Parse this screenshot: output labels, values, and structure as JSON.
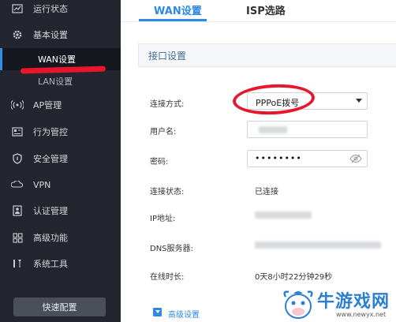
{
  "sidebar": {
    "items": [
      {
        "label": "运行状态",
        "icon": "monitor-icon"
      },
      {
        "label": "基本设置",
        "icon": "gear-icon"
      },
      {
        "label": "AP管理",
        "icon": "wifi-ap-icon"
      },
      {
        "label": "行为管控",
        "icon": "control-icon"
      },
      {
        "label": "安全管理",
        "icon": "shield-icon"
      },
      {
        "label": "VPN",
        "icon": "vpn-icon"
      },
      {
        "label": "认证管理",
        "icon": "auth-icon"
      },
      {
        "label": "高级功能",
        "icon": "grid-icon"
      },
      {
        "label": "系统工具",
        "icon": "tools-icon"
      }
    ],
    "sub_items": [
      {
        "label": "WAN设置",
        "active": true
      },
      {
        "label": "LAN设置",
        "active": false
      }
    ],
    "quick_config": "快速配置"
  },
  "tabs": [
    {
      "label": "WAN设置",
      "active": true
    },
    {
      "label": "ISP选路",
      "active": false
    }
  ],
  "section": {
    "title": "接口设置"
  },
  "form": {
    "connection_type": {
      "label": "连接方式:",
      "value": "PPPoE拨号"
    },
    "username": {
      "label": "用户名:"
    },
    "password": {
      "label": "密码:",
      "value": "••••••••"
    },
    "status": {
      "label": "连接状态:",
      "value": "已连接"
    },
    "ip": {
      "label": "IP地址:"
    },
    "dns": {
      "label": "DNS服务器:"
    },
    "online_time": {
      "label": "在线时长:",
      "value": "0天8小时22分钟29秒"
    }
  },
  "advanced": {
    "label": "高级设置"
  },
  "watermark": {
    "brand": "牛游戏网",
    "url": "www.newyx.net"
  },
  "colors": {
    "accent": "#2d8ae3",
    "sidebar_bg": "#23262e",
    "annotation_red": "#e8162c"
  }
}
